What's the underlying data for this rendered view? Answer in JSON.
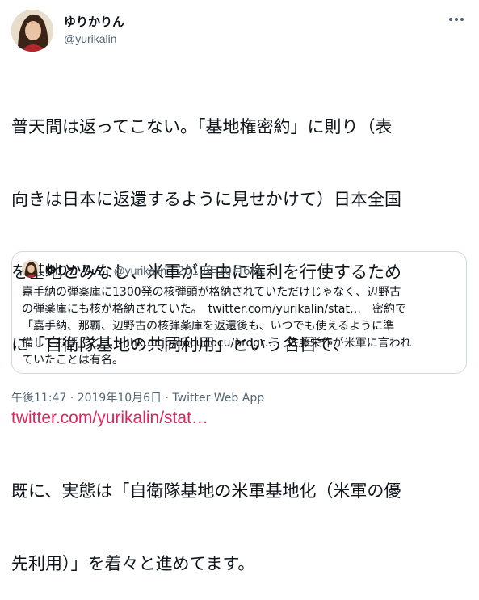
{
  "author": {
    "display_name": "ゆりかりん",
    "handle": "@yurikalin"
  },
  "tweet": {
    "lines": [
      "普天間は返ってこない。「基地権密約」に則り（表",
      "向きは日本に返還するように見せかけて）日本全国",
      "を基地とみなし、米軍が自由に権利を行使するため",
      "に「自衛隊基地の共同利用」という名目で、"
    ],
    "link": "twitter.com/yurikalin/stat…",
    "lines_after": [
      "既に、実態は「自衛隊基地の米軍基地化（米軍の優",
      "先利用）」を着々と進めてます。"
    ]
  },
  "quote": {
    "display_name": "ゆりかりん",
    "handle": "@yurikalin",
    "separator": "·",
    "date": "2019年10月6日",
    "lines": [
      "嘉手納の弾薬庫に1300発の核弾頭が格納されていただけじゃなく、辺野古",
      "の弾薬庫にも核が格納されていた。　twitter.com/yurikalin/stat…　密約で",
      "「嘉手納、那覇、辺野古の核弾薬庫を返還後も、いつでも使えるように準",
      "備しておけ」と　　nhk.or.jp/docudocu/progr…　佐藤栄作が米軍に言われ",
      "ていたことは有名。"
    ]
  },
  "meta": {
    "text": "午後11:47 · 2019年10月6日 · Twitter Web App"
  },
  "colors": {
    "link": "#e0245e",
    "secondary_text": "#536471",
    "border": "#cfd9de"
  },
  "icons": {
    "more": "more-horizontal-icon"
  }
}
